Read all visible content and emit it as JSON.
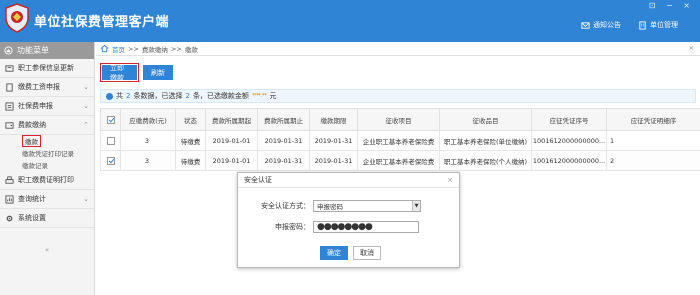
{
  "header": {
    "title": "单位社保费管理客户端",
    "notice_label": "通知公告",
    "unit_label": "单位管理",
    "window_controls": "⊡ − ×"
  },
  "sidebar": {
    "menu_title": "功能菜单",
    "items": [
      {
        "label": "职工参保信息更新"
      },
      {
        "label": "缴费工资申报"
      },
      {
        "label": "社保费申报"
      },
      {
        "label": "费款缴纳"
      },
      {
        "label": "职工缴费证明打印"
      },
      {
        "label": "查询统计"
      },
      {
        "label": "系统设置"
      }
    ],
    "subitems": [
      {
        "label": "缴款"
      },
      {
        "label": "缴款凭证打印记录"
      },
      {
        "label": "缴款记录"
      }
    ]
  },
  "breadcrumb": {
    "home": "首页",
    "sep1": ">>",
    "level1": "费款缴纳",
    "sep2": ">>",
    "level2": "缴款"
  },
  "toolbar": {
    "pay_label": "立即缴款",
    "refresh_label": "刷新"
  },
  "summary": {
    "prefix": "共",
    "total": "2",
    "mid1": "条数据，已选择",
    "selected": "2",
    "mid2": "条，已选缴款金额",
    "amount_blurred": "****.**",
    "suffix": "元"
  },
  "table": {
    "columns": [
      "应缴费款(元)",
      "状态",
      "费款所属期起",
      "费款所属期止",
      "缴款期限",
      "征收项目",
      "征收品目",
      "应征凭证序号",
      "应征凭证明细序"
    ],
    "rows": [
      {
        "checked": false,
        "amount": "3",
        "status": "待缴费",
        "start": "2019-01-01",
        "end": "2019-01-31",
        "deadline": "2019-01-31",
        "item": "企业职工基本养老保险费",
        "subitem": "职工基本养老保险(单位缴纳)",
        "voucher": "1001612000000000...",
        "detail": "1"
      },
      {
        "checked": true,
        "amount": "3",
        "status": "待缴费",
        "start": "2019-01-01",
        "end": "2019-01-31",
        "deadline": "2019-01-31",
        "item": "企业职工基本养老保险费",
        "subitem": "职工基本养老保险(个人缴纳)",
        "voucher": "1001612000000000...",
        "detail": "2"
      }
    ]
  },
  "dialog": {
    "title": "安全认证",
    "method_label": "安全认证方式：",
    "method_value": "申报密码",
    "password_label": "申报密码：",
    "password_value": "●●●●●●●●",
    "ok_label": "确定",
    "cancel_label": "取消"
  },
  "colors": {
    "brand_blue": "#2f84d6",
    "highlight_red": "#d9232d"
  }
}
